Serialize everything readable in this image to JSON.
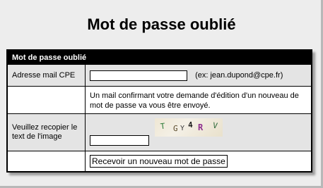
{
  "page": {
    "title": "Mot de passe oublié"
  },
  "form": {
    "header": "Mot de passe oublié",
    "email_label": "Adresse mail CPE",
    "email_value": "",
    "email_hint": "(ex: jean.dupond@cpe.fr)",
    "info_text": "Un mail confirmant votre demande d'édition d'un nouveau de mot de passe va vous être envoyé.",
    "captcha_label": "Veuillez recopier le text de l'image",
    "captcha_chars": [
      "T",
      "G",
      "Y",
      "4",
      "R",
      "V"
    ],
    "captcha_value": "",
    "submit_label": "Recevoir un nouveau mot de passe"
  },
  "colors": {
    "header_bg": "#000000",
    "label_bg": "#e4e4e4",
    "page_bg": "#ededed"
  }
}
